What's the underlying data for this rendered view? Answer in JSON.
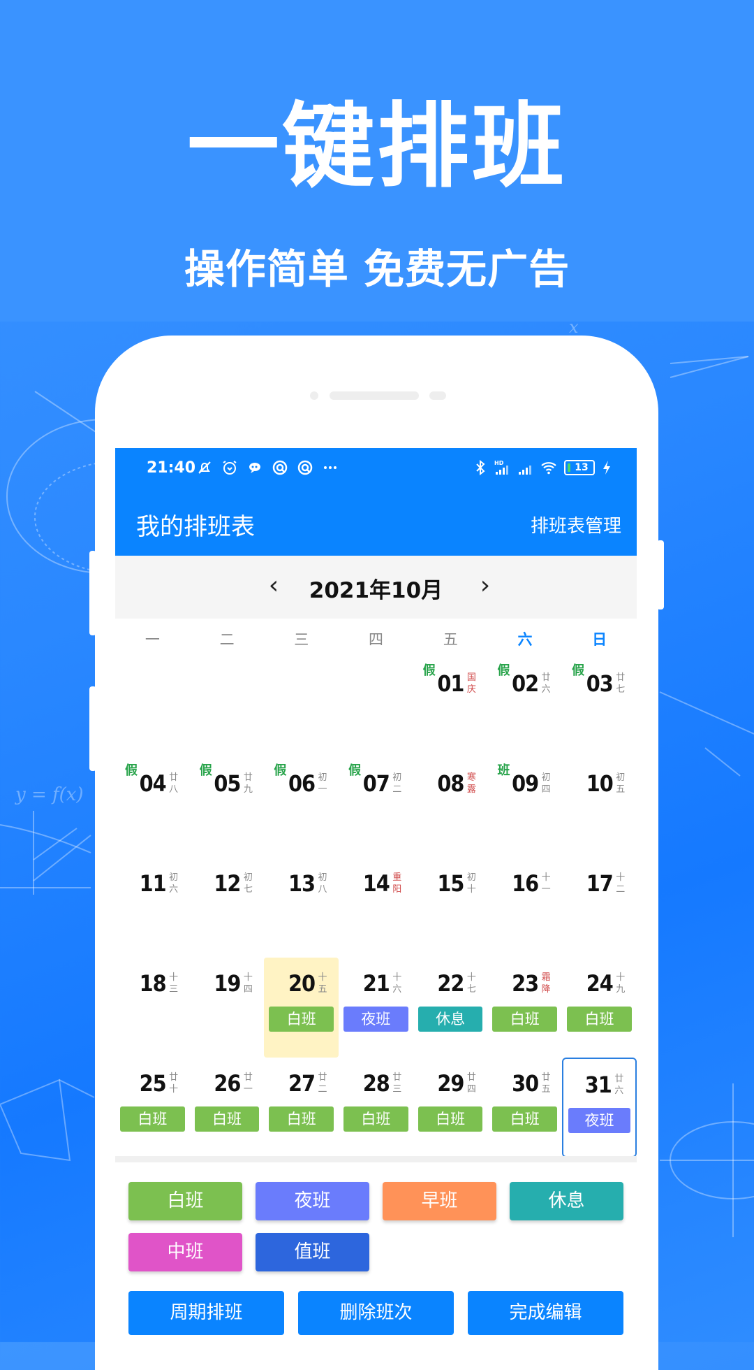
{
  "promo": {
    "headline": "一键排班",
    "subheadline": "操作简单 免费无广告"
  },
  "status_bar": {
    "time": "21:40",
    "left_icons": [
      "mute-bell-icon",
      "alarm-icon",
      "chat-bubble-icon",
      "app-circle-icon",
      "app-circle-icon",
      "more-dots-icon"
    ],
    "right_icons": [
      "bluetooth-icon",
      "hd-signal-icon",
      "signal-icon",
      "wifi-icon",
      "battery-icon",
      "charging-icon"
    ],
    "battery_level": "13"
  },
  "app_bar": {
    "title": "我的排班表",
    "action": "排班表管理"
  },
  "month_nav": {
    "prev": "‹",
    "title": "2021年10月",
    "next": "›"
  },
  "weekdays": [
    {
      "label": "一",
      "weekend": false
    },
    {
      "label": "二",
      "weekend": false
    },
    {
      "label": "三",
      "weekend": false
    },
    {
      "label": "四",
      "weekend": false
    },
    {
      "label": "五",
      "weekend": false
    },
    {
      "label": "六",
      "weekend": true
    },
    {
      "label": "日",
      "weekend": true
    }
  ],
  "calendar": {
    "weeks": [
      [
        null,
        null,
        null,
        null,
        {
          "day": "01",
          "lunar": "国庆",
          "festival": true,
          "tag": "假"
        },
        {
          "day": "02",
          "lunar": "廿六",
          "tag": "假"
        },
        {
          "day": "03",
          "lunar": "廿七",
          "tag": "假"
        }
      ],
      [
        {
          "day": "04",
          "lunar": "廿八",
          "tag": "假"
        },
        {
          "day": "05",
          "lunar": "廿九",
          "tag": "假"
        },
        {
          "day": "06",
          "lunar": "初一",
          "tag": "假"
        },
        {
          "day": "07",
          "lunar": "初二",
          "tag": "假"
        },
        {
          "day": "08",
          "lunar": "寒露",
          "festival": true
        },
        {
          "day": "09",
          "lunar": "初四",
          "tag": "班"
        },
        {
          "day": "10",
          "lunar": "初五"
        }
      ],
      [
        {
          "day": "11",
          "lunar": "初六"
        },
        {
          "day": "12",
          "lunar": "初七"
        },
        {
          "day": "13",
          "lunar": "初八"
        },
        {
          "day": "14",
          "lunar": "重阳",
          "festival": true
        },
        {
          "day": "15",
          "lunar": "初十"
        },
        {
          "day": "16",
          "lunar": "十一"
        },
        {
          "day": "17",
          "lunar": "十二"
        }
      ],
      [
        {
          "day": "18",
          "lunar": "十三"
        },
        {
          "day": "19",
          "lunar": "十四"
        },
        {
          "day": "20",
          "lunar": "十五",
          "today": true,
          "shift": "白班"
        },
        {
          "day": "21",
          "lunar": "十六",
          "shift": "夜班"
        },
        {
          "day": "22",
          "lunar": "十七",
          "shift": "休息"
        },
        {
          "day": "23",
          "lunar": "霜降",
          "festival": true,
          "shift": "白班"
        },
        {
          "day": "24",
          "lunar": "十九",
          "shift": "白班"
        }
      ],
      [
        {
          "day": "25",
          "lunar": "廿十",
          "shift": "白班"
        },
        {
          "day": "26",
          "lunar": "廿一",
          "shift": "白班"
        },
        {
          "day": "27",
          "lunar": "廿二",
          "shift": "白班"
        },
        {
          "day": "28",
          "lunar": "廿三",
          "shift": "白班"
        },
        {
          "day": "29",
          "lunar": "廿四",
          "shift": "白班"
        },
        {
          "day": "30",
          "lunar": "廿五",
          "shift": "白班"
        },
        {
          "day": "31",
          "lunar": "廿六",
          "selected": true,
          "shift": "夜班"
        }
      ]
    ]
  },
  "shift_types": [
    {
      "label": "白班",
      "color": "#7cc050"
    },
    {
      "label": "夜班",
      "color": "#6a7cfc"
    },
    {
      "label": "早班",
      "color": "#ff9258"
    },
    {
      "label": "休息",
      "color": "#26aeae"
    },
    {
      "label": "中班",
      "color": "#e054c8"
    },
    {
      "label": "值班",
      "color": "#2d66dd"
    }
  ],
  "actions": {
    "cycle": "周期排班",
    "delete": "删除班次",
    "done": "完成编辑"
  },
  "colors": {
    "primary": "#0a84ff",
    "holiday_tag": "#27a34a",
    "festival": "#d04a4a",
    "today_bg": "#fff3c4"
  }
}
